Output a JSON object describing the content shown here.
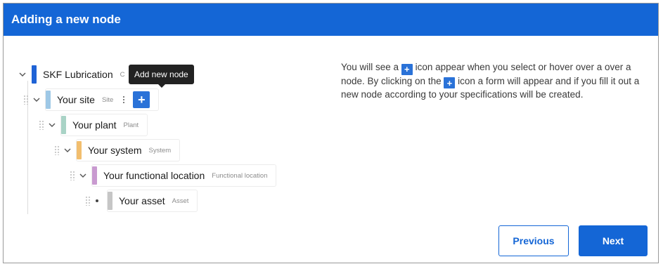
{
  "header": {
    "title": "Adding a new node"
  },
  "tree": {
    "root": {
      "name": "SKF Lubrication",
      "type": "C",
      "color": "#1f63d6"
    },
    "nodes": [
      {
        "name": "Your site",
        "type": "Site",
        "color": "#9ec8e6"
      },
      {
        "name": "Your plant",
        "type": "Plant",
        "color": "#a9d3c6"
      },
      {
        "name": "Your system",
        "type": "System",
        "color": "#f2be6e"
      },
      {
        "name": "Your functional location",
        "type": "Functional location",
        "color": "#c99ad0"
      },
      {
        "name": "Your asset",
        "type": "Asset",
        "color": "#c6c6c6"
      }
    ],
    "add_button_symbol": "+",
    "tooltip": "Add new node"
  },
  "info": {
    "part1": "You will see a",
    "part2": "icon appear when you select or hover over a over a node. By clicking on the",
    "part3": "icon a form will appear and if you fill it out a new node according to your specifications will be created.",
    "plus_symbol": "+"
  },
  "buttons": {
    "previous": "Previous",
    "next": "Next"
  },
  "colors": {
    "accent": "#1466d6",
    "add_button": "#2a72d8"
  }
}
